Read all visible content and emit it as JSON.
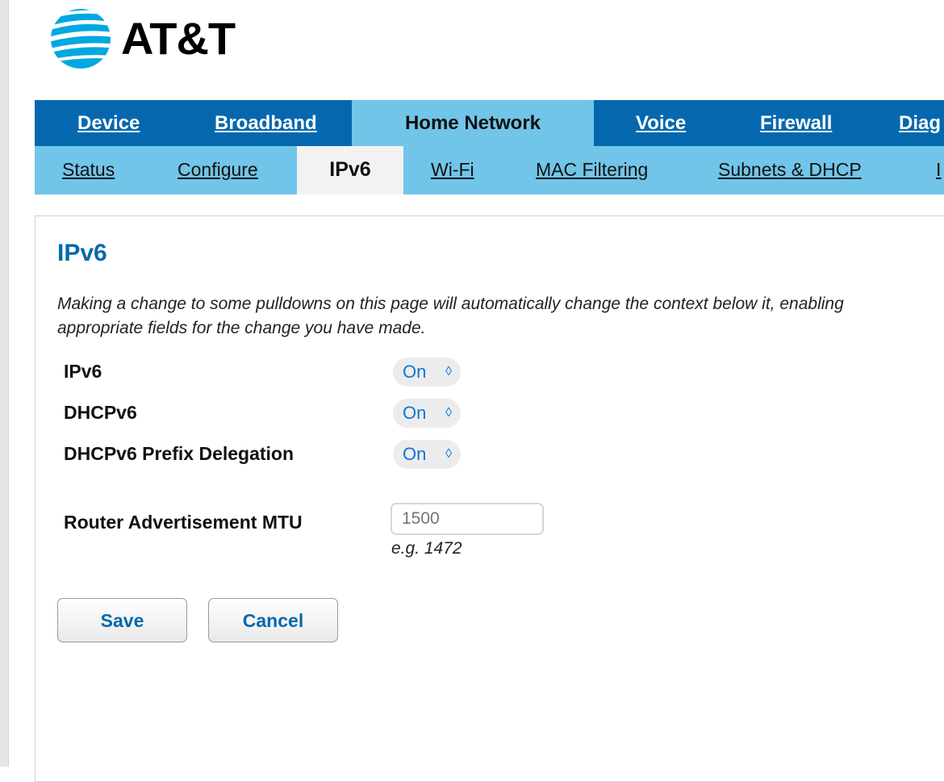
{
  "brand": {
    "name": "AT&T",
    "logo_color": "#00a8e0"
  },
  "colors": {
    "nav_primary": "#0568ae",
    "nav_secondary": "#71c5e8",
    "title": "#0568ae"
  },
  "nav_primary": [
    {
      "label": "Device"
    },
    {
      "label": "Broadband"
    },
    {
      "label": "Home Network",
      "active": true
    },
    {
      "label": "Voice"
    },
    {
      "label": "Firewall"
    },
    {
      "label": "Diag"
    }
  ],
  "nav_secondary": [
    {
      "label": "Status"
    },
    {
      "label": "Configure"
    },
    {
      "label": "IPv6",
      "active": true
    },
    {
      "label": "Wi-Fi"
    },
    {
      "label": "MAC Filtering"
    },
    {
      "label": "Subnets & DHCP"
    },
    {
      "label": "I"
    }
  ],
  "page": {
    "title": "IPv6",
    "intro_line1": "Making a change to some pulldowns on this page will automatically change the context below it, enabling",
    "intro_line2": "appropriate fields for the change you have made."
  },
  "form": {
    "ipv6": {
      "label": "IPv6",
      "value": "On"
    },
    "dhcpv6": {
      "label": "DHCPv6",
      "value": "On"
    },
    "prefix_delegation": {
      "label": "DHCPv6 Prefix Delegation",
      "value": "On"
    },
    "mtu": {
      "label": "Router Advertisement MTU",
      "placeholder": "1500",
      "value": "",
      "hint": "e.g. 1472"
    }
  },
  "buttons": {
    "save": "Save",
    "cancel": "Cancel"
  },
  "icons": {
    "select_chevron": "chevron-up-down-icon",
    "logo": "att-globe-icon"
  }
}
